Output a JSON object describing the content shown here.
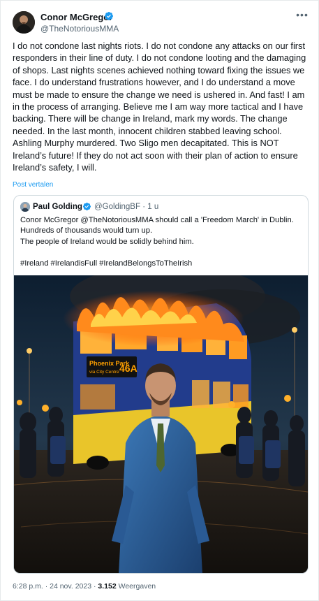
{
  "author": {
    "name": "Conor McGregor",
    "handle": "@TheNotoriousMMA",
    "verified": true
  },
  "more_icon": "more-horizontal-icon",
  "tweet": {
    "text": "I do not condone last nights riots. I do not condone any attacks on our first responders in their line of duty. I do not condone looting and the damaging of shops. Last nights scenes achieved nothing toward fixing the issues we face. I do understand frustrations however, and I do understand a move must be made to ensure the change we need is ushered in. And fast! I am in the process of arranging. Believe me I am way more tactical and I have backing. There will be change in Ireland, mark my words. The change needed. In the last month, innocent children stabbed leaving school. Ashling Murphy murdered. Two Sligo men decapitated. This is NOT Ireland’s future! If they do not act soon with their plan of action to ensure Ireland’s safety, I will.",
    "translate_label": "Post vertalen"
  },
  "quote": {
    "name": "Paul Golding",
    "handle": "@GoldingBF",
    "separator": "·",
    "time": "1 u",
    "lines": [
      "Conor McGregor @TheNotoriousMMA should call a 'Freedom March' in Dublin.",
      "Hundreds of thousands would turn up.",
      "The people of Ireland would be solidly behind him.",
      "",
      "#Ireland #IrelandisFull #IrelandBelongsToTheIrish"
    ],
    "image": {
      "bus_sign_line1": "Phoenix Park",
      "bus_sign_line2": "via City Centre",
      "bus_route": "46A"
    }
  },
  "meta": {
    "time": "6:28 p.m.",
    "separator": "·",
    "date": "24 nov. 2023",
    "views_count": "3.152",
    "views_label": "Weergaven"
  },
  "colors": {
    "verified": "#1d9bf0",
    "link": "#1d9bf0",
    "secondary": "#536471"
  }
}
